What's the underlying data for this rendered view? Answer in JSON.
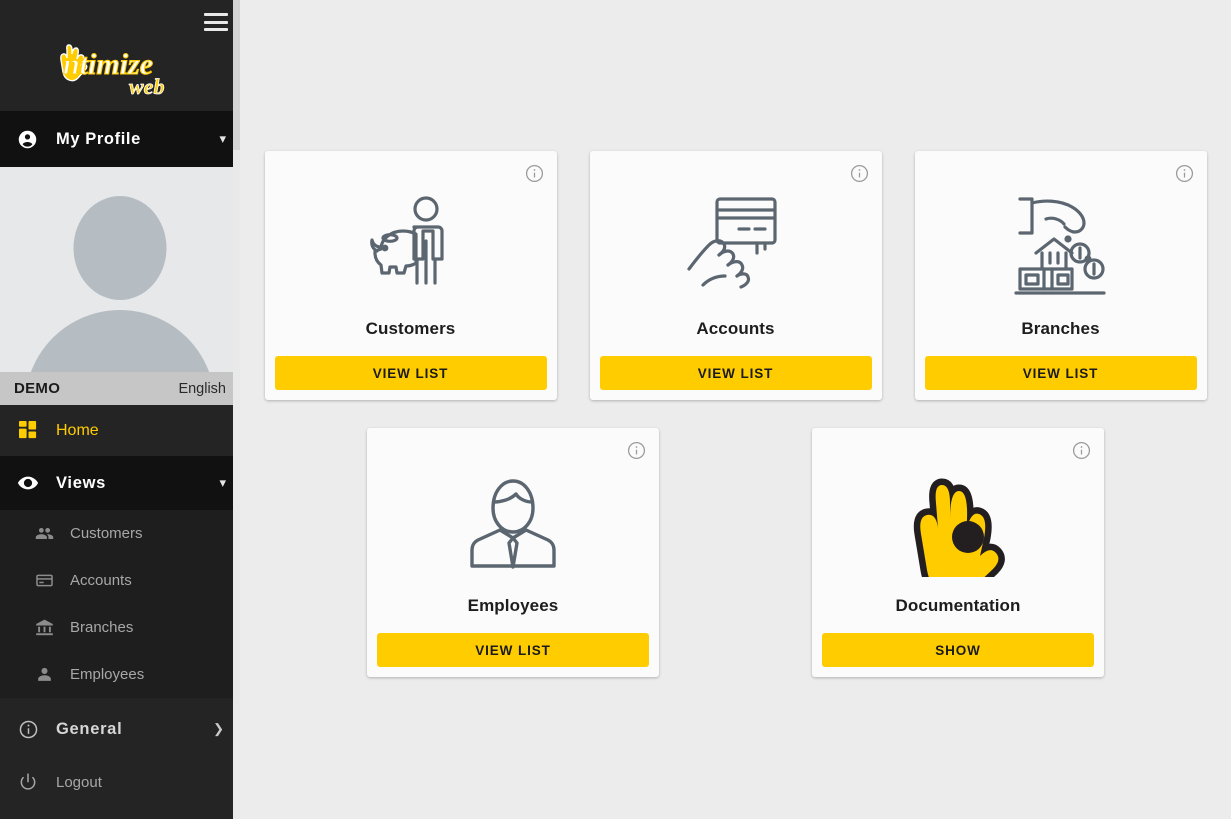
{
  "sidebar": {
    "menu_icon": "hamburger-menu-icon",
    "logo": {
      "text": "Ontimize",
      "sub_text": "web",
      "icon": "ok-hand-logo-icon"
    },
    "profile": {
      "label": "My Profile",
      "icon": "account-circle-icon",
      "expander": "chevron-down-icon"
    },
    "avatar": {
      "icon": "user-avatar-placeholder"
    },
    "status_bar": {
      "environment": "DEMO",
      "language": "English"
    },
    "nav": [
      {
        "label": "Home",
        "icon": "dashboard-grid-icon",
        "active": true
      },
      {
        "label": "Views",
        "icon": "eye-icon",
        "expander": "chevron-down-icon",
        "expanded": true
      }
    ],
    "submenu": [
      {
        "label": "Customers",
        "icon": "people-icon"
      },
      {
        "label": "Accounts",
        "icon": "credit-card-icon"
      },
      {
        "label": "Branches",
        "icon": "bank-icon"
      },
      {
        "label": "Employees",
        "icon": "person-icon"
      }
    ],
    "general": {
      "label": "General",
      "icon": "info-circle-icon",
      "expander": "chevron-right-icon"
    },
    "logout": {
      "label": "Logout",
      "icon": "power-icon"
    }
  },
  "main": {
    "cards": [
      {
        "title": "Customers",
        "button": "VIEW LIST",
        "icon": "customer-piggybank-icon",
        "info_icon": "info-circle-icon"
      },
      {
        "title": "Accounts",
        "button": "VIEW LIST",
        "icon": "hand-credit-card-icon",
        "info_icon": "info-circle-icon"
      },
      {
        "title": "Branches",
        "button": "VIEW LIST",
        "icon": "hand-coins-bank-icon",
        "info_icon": "info-circle-icon"
      },
      {
        "title": "Employees",
        "button": "VIEW LIST",
        "icon": "businessperson-icon",
        "info_icon": "info-circle-icon"
      },
      {
        "title": "Documentation",
        "button": "SHOW",
        "icon": "ok-hand-logo-icon",
        "info_icon": "info-circle-icon"
      }
    ]
  },
  "colors": {
    "accent_yellow": "#ffcc00",
    "sidebar_dark": "#242424",
    "sidebar_darker": "#111111",
    "submenu_bg": "#1e1e1e",
    "content_bg": "#ececec",
    "card_bg": "#fbfbfb",
    "status_bar_bg": "#c6c6c6",
    "icon_stroke": "#5b6670"
  }
}
